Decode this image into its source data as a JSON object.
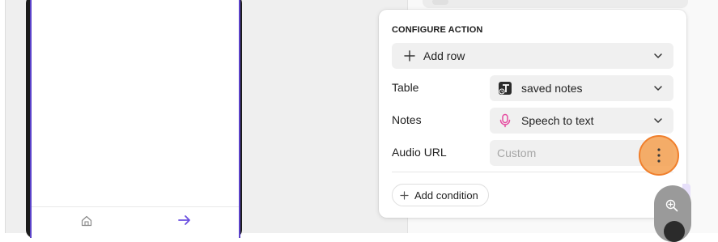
{
  "card": {
    "title": "CONFIGURE ACTION",
    "action": {
      "label": "Add row",
      "icon": "plus-icon"
    },
    "rows": [
      {
        "label": "Table",
        "value": "saved notes",
        "icon": "table-icon"
      },
      {
        "label": "Notes",
        "value": "Speech to text",
        "icon": "microphone-icon",
        "icon_color": "#e64ba0"
      },
      {
        "label": "Audio URL",
        "placeholder": "Custom"
      }
    ],
    "add_condition_label": "Add condition"
  },
  "colors": {
    "accent_purple": "#5b43c9",
    "highlight_orange": "#f07f2c"
  },
  "phone_nav": {
    "home_icon": "home-icon",
    "next_icon": "arrow-right-icon"
  },
  "floating": {
    "zoom_icon": "zoom-in-icon",
    "kebab_icon": "more-vertical-icon"
  }
}
